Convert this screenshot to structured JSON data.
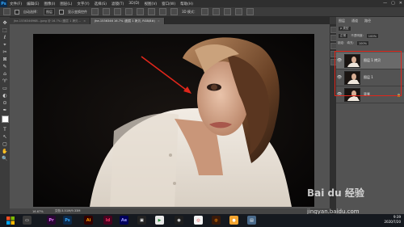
{
  "app": {
    "logo": "Ps"
  },
  "menubar": {
    "items": [
      "文件(F)",
      "编辑(E)",
      "图像(I)",
      "图层(L)",
      "文字(Y)",
      "选择(S)",
      "滤镜(T)",
      "3D(D)",
      "视图(V)",
      "窗口(W)",
      "帮助(H)"
    ],
    "win_min": "—",
    "win_max": "▢",
    "win_close": "✕"
  },
  "options": {
    "auto_select_label": "自动选择：",
    "auto_select_value": "图层",
    "show_transform_label": "显示变换控件",
    "mode_label": "3D 模式："
  },
  "tabs": [
    {
      "label": "jhe-1536346968...jpeg @ 16.7% (图层 1 拷贝...",
      "close": "×"
    },
    {
      "label": "jhe-1536346 16.7% (图层 1 拷贝, RGB/8#)",
      "close": "×"
    }
  ],
  "tools": [
    "✥",
    "⬚",
    "ℓ",
    "⌖",
    "✂",
    "⊠",
    "✎",
    "⌂",
    "♈",
    "▭",
    "◐",
    "⊙",
    "✒",
    "T",
    "↖",
    "▢",
    "✋",
    "🔍"
  ],
  "status": {
    "zoom": "16.67%",
    "doc": "文档:3.51M/9.33M"
  },
  "panel": {
    "tabs": [
      "图层",
      "通道",
      "路径"
    ],
    "kind_label": "ρ 类型",
    "blend_mode": "正常",
    "opacity_label": "不透明度:",
    "opacity_value": "100%",
    "lock_label": "锁定:",
    "fill_label": "填充:",
    "fill_value": "100%"
  },
  "layers": [
    {
      "name": "图层 1 拷贝",
      "selected": true,
      "eye": "👁"
    },
    {
      "name": "图层 1",
      "selected": false,
      "eye": "👁"
    },
    {
      "name": "背景",
      "selected": false,
      "eye": "👁",
      "lock": "🔒"
    }
  ],
  "taskbar": {
    "apps": [
      {
        "label": "Pr",
        "color": "#2a0634",
        "fg": "#e77cff"
      },
      {
        "label": "Ps",
        "color": "#0d2a4a",
        "fg": "#31a8ff"
      },
      {
        "label": "Ai",
        "color": "#330000",
        "fg": "#ff9a00"
      },
      {
        "label": "Id",
        "color": "#49021f",
        "fg": "#ff3366"
      },
      {
        "label": "Ae",
        "color": "#00005b",
        "fg": "#9999ff"
      }
    ],
    "time": "9:39",
    "date": "2020/7/20"
  },
  "watermark": {
    "brand": "Bai du 经验",
    "url": "jingyan.baidu.com"
  }
}
